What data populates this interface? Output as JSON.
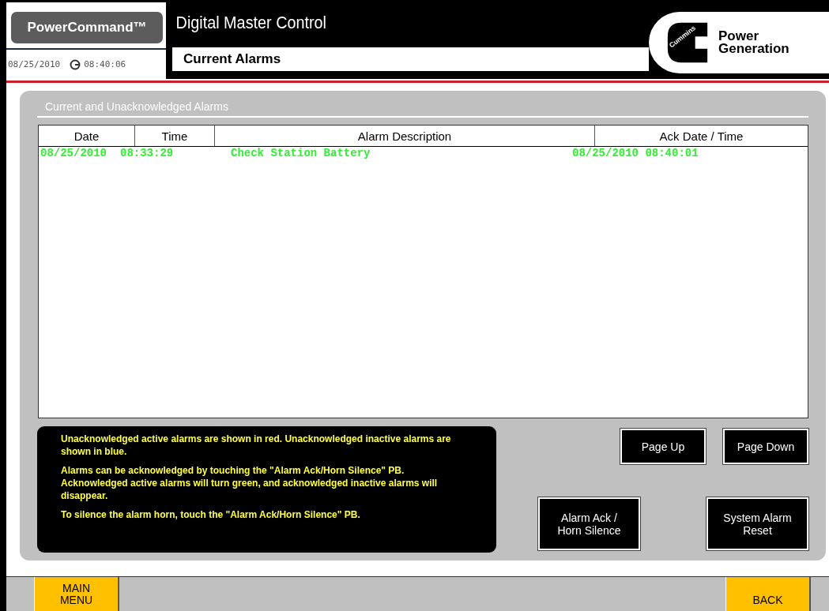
{
  "header": {
    "brand": "PowerCommand™",
    "title": "Digital Master Control",
    "date": "08/25/2010",
    "time": "08:40:06",
    "screen_title": "Current Alarms",
    "logo_mark": "Cummins",
    "logo_text": [
      "Power",
      "Generation"
    ]
  },
  "panel": {
    "title": "Current and Unacknowledged Alarms"
  },
  "table": {
    "columns": [
      "Date",
      "Time",
      "Alarm Description",
      "Ack Date / Time"
    ],
    "rows": [
      {
        "color": "#33ee33",
        "cells": [
          "08/25/2010",
          "08:33:29",
          "Check Station Battery",
          "08/25/2010 08:40:01"
        ]
      }
    ]
  },
  "info": [
    "Unacknowledged active alarms are shown in red. Unacknowledged inactive alarms are shown in blue.",
    "Alarms can be acknowledged by touching the \"Alarm Ack/Horn Silence\" PB. Acknowledged active alarms will turn green, and acknowledged inactive alarms will disappear.",
    "To silence the alarm horn, touch the \"Alarm Ack/Horn Silence\" PB."
  ],
  "buttons": {
    "page_up": "Page Up",
    "page_down": "Page Down",
    "ack": [
      "Alarm Ack /",
      "Horn Silence"
    ],
    "reset": [
      "System Alarm",
      "Reset"
    ]
  },
  "footer": {
    "left": [
      "MAIN",
      "MENU"
    ],
    "right": "BACK"
  }
}
